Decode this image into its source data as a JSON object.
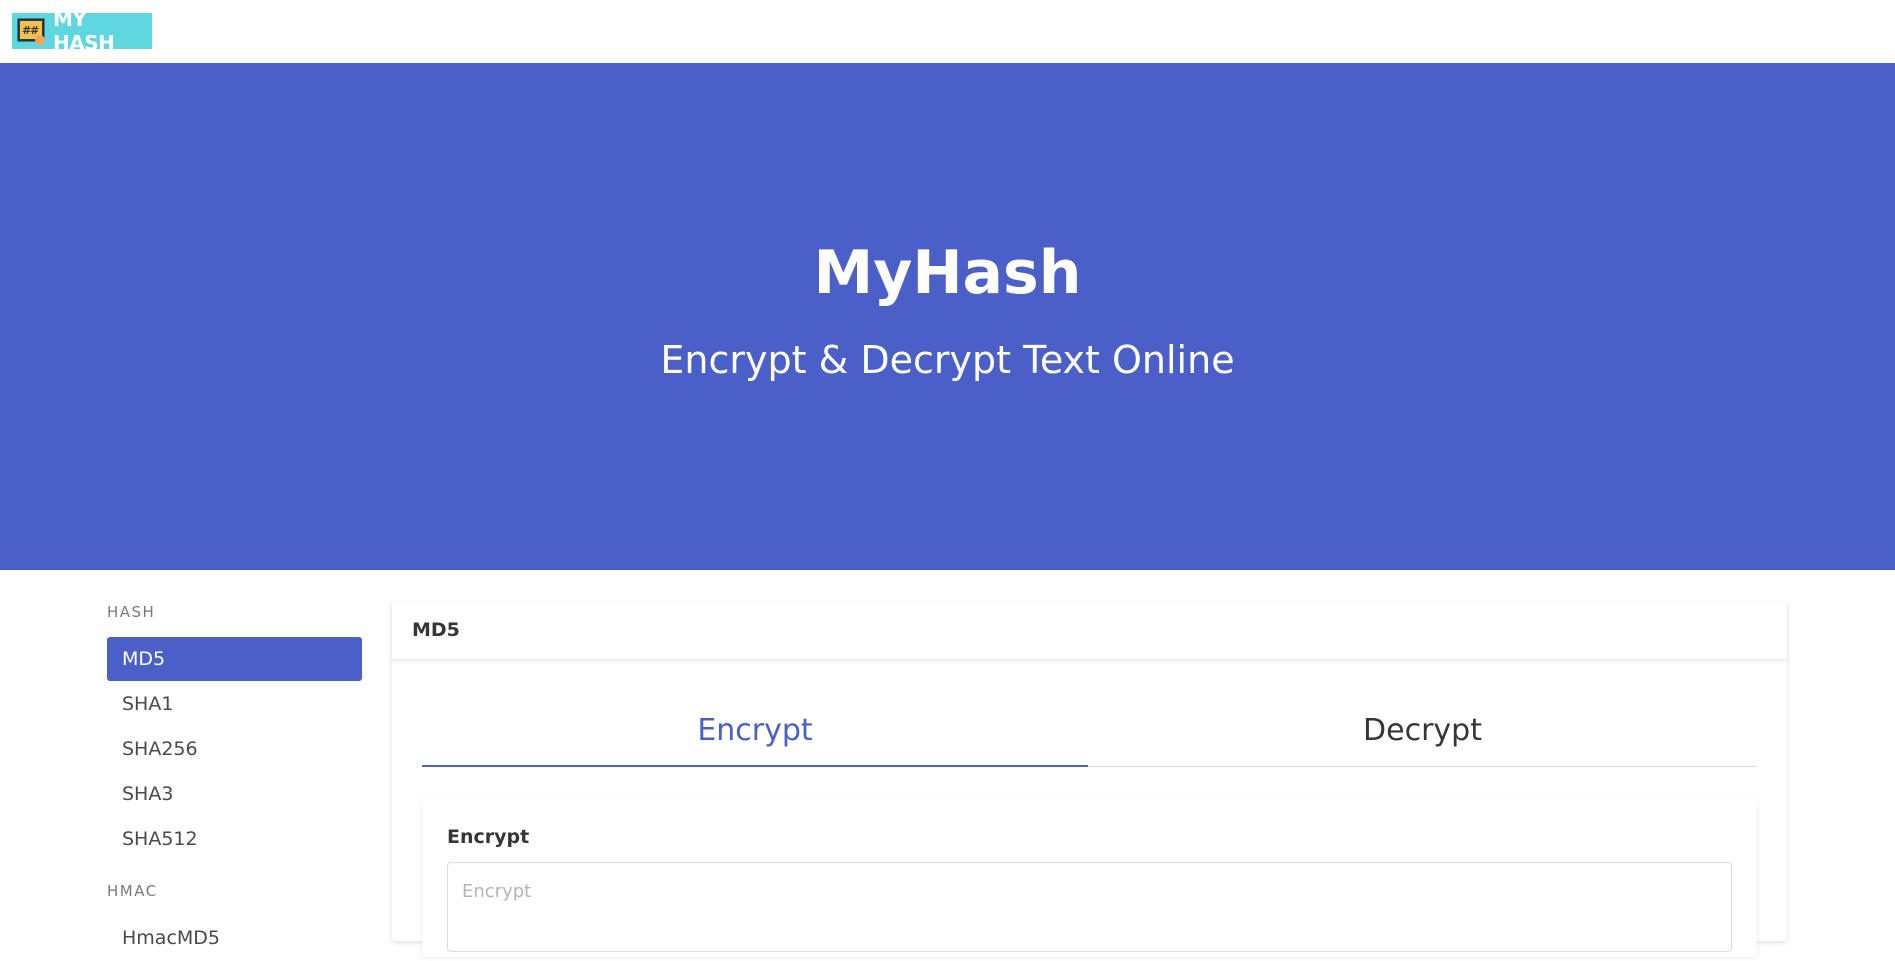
{
  "brand": {
    "label": "MY HASH",
    "icon": "hash-pointer-logo"
  },
  "hero": {
    "title": "MyHash",
    "subtitle": "Encrypt & Decrypt Text Online"
  },
  "sidebar": {
    "sections": [
      {
        "label": "HASH",
        "items": [
          "MD5",
          "SHA1",
          "SHA256",
          "SHA3",
          "SHA512"
        ],
        "active": "MD5"
      },
      {
        "label": "HMAC",
        "items": [
          "HmacMD5"
        ]
      }
    ]
  },
  "card": {
    "title": "MD5",
    "tabs": [
      {
        "label": "Encrypt",
        "active": true
      },
      {
        "label": "Decrypt",
        "active": false
      }
    ],
    "field": {
      "label": "Encrypt",
      "placeholder": "Encrypt",
      "value": ""
    }
  },
  "colors": {
    "primary": "#4a60c8",
    "brand_bg": "#5fd7e0"
  }
}
